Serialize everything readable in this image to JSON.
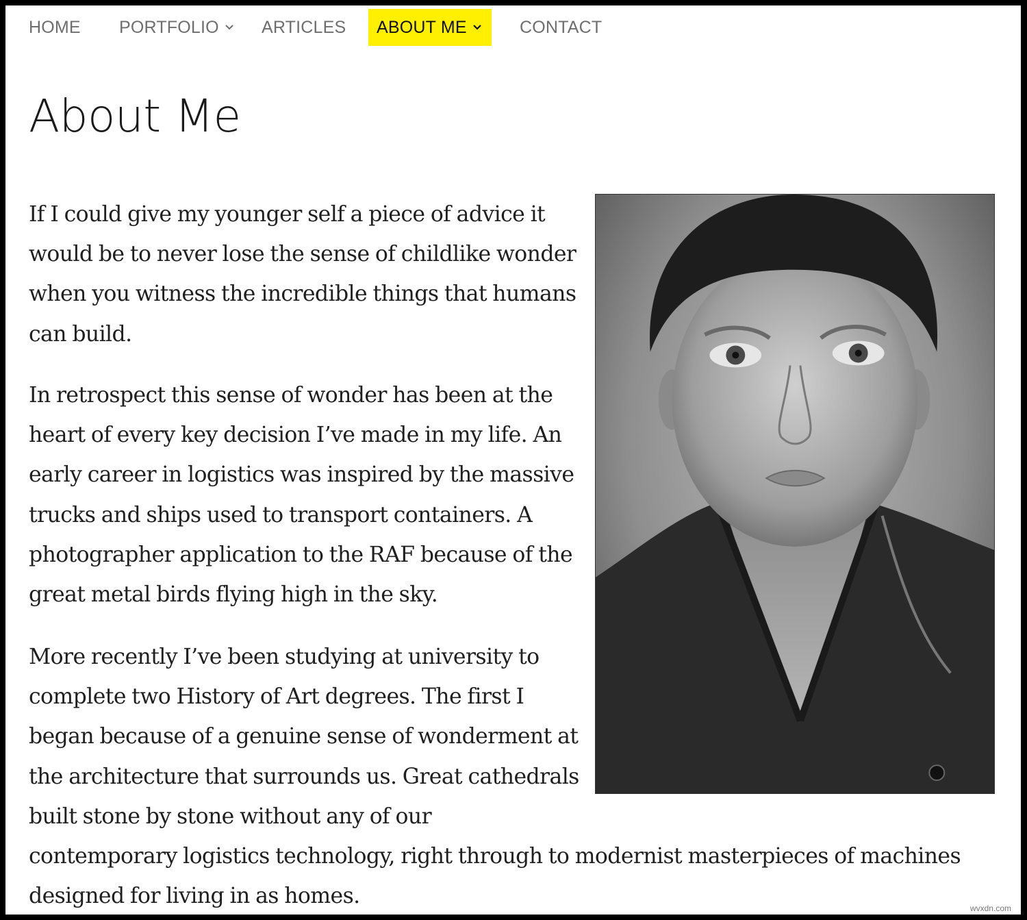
{
  "nav": {
    "items": [
      {
        "label": "HOME"
      },
      {
        "label": "PORTFOLIO"
      },
      {
        "label": "ARTICLES"
      },
      {
        "label": "ABOUT ME"
      },
      {
        "label": "CONTACT"
      }
    ],
    "active_color": "#ffef00"
  },
  "page": {
    "title": "About Me"
  },
  "content": {
    "paragraph1": "If I could give my younger self a piece of advice it would be to never lose the sense of childlike wonder when you witness the incredible things that humans can build.",
    "paragraph2": "In retrospect this sense of wonder has been at the heart of every key decision I’ve made in my life. An early career in logistics was inspired by the massive trucks and ships used to transport containers. A photographer application to the RAF because of the great metal birds flying high in the sky.",
    "paragraph3_part1": "More recently I’ve been studying at university to complete two History of Art degrees. The first I began because of a genuine sense of wonderment at the architecture that surrounds us. Great cathedrals built stone by stone without any of our",
    "paragraph3_part2": "contemporary logistics technology, right through to modernist masterpieces of machines designed for living in as homes."
  },
  "portrait": {
    "icon": "portrait-photo"
  },
  "watermark": "wvxdn.com"
}
